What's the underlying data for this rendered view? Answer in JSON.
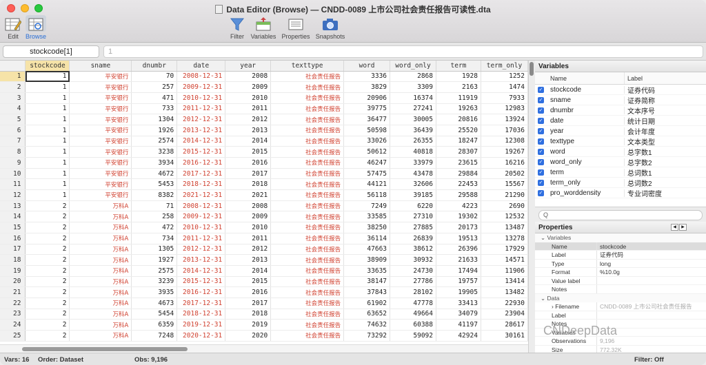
{
  "window": {
    "title": "Data Editor (Browse) — CNDD-0089 上市公司社会责任报告可读性.dta"
  },
  "toolbar": {
    "edit": "Edit",
    "browse": "Browse",
    "filter": "Filter",
    "variables": "Variables",
    "properties": "Properties",
    "snapshots": "Snapshots"
  },
  "cmdbar": {
    "cell_name": "stockcode[1]",
    "cell_value": "1"
  },
  "grid": {
    "columns": [
      "stockcode",
      "sname",
      "dnumbr",
      "date",
      "year",
      "texttype",
      "word",
      "word_only",
      "term",
      "term_only"
    ],
    "rows": [
      [
        "1",
        "1",
        "平安银行",
        "70",
        "2008-12-31",
        "2008",
        "社会责任报告",
        "3336",
        "2868",
        "1928",
        "1252"
      ],
      [
        "2",
        "1",
        "平安银行",
        "257",
        "2009-12-31",
        "2009",
        "社会责任报告",
        "3829",
        "3309",
        "2163",
        "1474"
      ],
      [
        "3",
        "1",
        "平安银行",
        "471",
        "2010-12-31",
        "2010",
        "社会责任报告",
        "20906",
        "16374",
        "11919",
        "7933"
      ],
      [
        "4",
        "1",
        "平安银行",
        "733",
        "2011-12-31",
        "2011",
        "社会责任报告",
        "39775",
        "27241",
        "19263",
        "12983"
      ],
      [
        "5",
        "1",
        "平安银行",
        "1304",
        "2012-12-31",
        "2012",
        "社会责任报告",
        "36477",
        "30005",
        "20816",
        "13924"
      ],
      [
        "6",
        "1",
        "平安银行",
        "1926",
        "2013-12-31",
        "2013",
        "社会责任报告",
        "50598",
        "36439",
        "25520",
        "17036"
      ],
      [
        "7",
        "1",
        "平安银行",
        "2574",
        "2014-12-31",
        "2014",
        "社会责任报告",
        "33026",
        "26355",
        "18247",
        "12308"
      ],
      [
        "8",
        "1",
        "平安银行",
        "3238",
        "2015-12-31",
        "2015",
        "社会责任报告",
        "50612",
        "40818",
        "28307",
        "19267"
      ],
      [
        "9",
        "1",
        "平安银行",
        "3934",
        "2016-12-31",
        "2016",
        "社会责任报告",
        "46247",
        "33979",
        "23615",
        "16216"
      ],
      [
        "10",
        "1",
        "平安银行",
        "4672",
        "2017-12-31",
        "2017",
        "社会责任报告",
        "57475",
        "43478",
        "29884",
        "20502"
      ],
      [
        "11",
        "1",
        "平安银行",
        "5453",
        "2018-12-31",
        "2018",
        "社会责任报告",
        "44121",
        "32606",
        "22453",
        "15567"
      ],
      [
        "12",
        "1",
        "平安银行",
        "8382",
        "2021-12-31",
        "2021",
        "社会责任报告",
        "56118",
        "39185",
        "29588",
        "21290"
      ],
      [
        "13",
        "2",
        "万科A",
        "71",
        "2008-12-31",
        "2008",
        "社会责任报告",
        "7249",
        "6220",
        "4223",
        "2690"
      ],
      [
        "14",
        "2",
        "万科A",
        "258",
        "2009-12-31",
        "2009",
        "社会责任报告",
        "33585",
        "27310",
        "19302",
        "12532"
      ],
      [
        "15",
        "2",
        "万科A",
        "472",
        "2010-12-31",
        "2010",
        "社会责任报告",
        "38250",
        "27885",
        "20173",
        "13487"
      ],
      [
        "16",
        "2",
        "万科A",
        "734",
        "2011-12-31",
        "2011",
        "社会责任报告",
        "36114",
        "26839",
        "19513",
        "13278"
      ],
      [
        "17",
        "2",
        "万科A",
        "1305",
        "2012-12-31",
        "2012",
        "社会责任报告",
        "47663",
        "38612",
        "26396",
        "17929"
      ],
      [
        "18",
        "2",
        "万科A",
        "1927",
        "2013-12-31",
        "2013",
        "社会责任报告",
        "38909",
        "30932",
        "21633",
        "14571"
      ],
      [
        "19",
        "2",
        "万科A",
        "2575",
        "2014-12-31",
        "2014",
        "社会责任报告",
        "33635",
        "24730",
        "17494",
        "11906"
      ],
      [
        "20",
        "2",
        "万科A",
        "3239",
        "2015-12-31",
        "2015",
        "社会责任报告",
        "38147",
        "27786",
        "19757",
        "13414"
      ],
      [
        "21",
        "2",
        "万科A",
        "3935",
        "2016-12-31",
        "2016",
        "社会责任报告",
        "37843",
        "28102",
        "19905",
        "13482"
      ],
      [
        "22",
        "2",
        "万科A",
        "4673",
        "2017-12-31",
        "2017",
        "社会责任报告",
        "61902",
        "47778",
        "33413",
        "22930"
      ],
      [
        "23",
        "2",
        "万科A",
        "5454",
        "2018-12-31",
        "2018",
        "社会责任报告",
        "63652",
        "49664",
        "34079",
        "23904"
      ],
      [
        "24",
        "2",
        "万科A",
        "6359",
        "2019-12-31",
        "2019",
        "社会责任报告",
        "74632",
        "60388",
        "41197",
        "28617"
      ],
      [
        "25",
        "2",
        "万科A",
        "7248",
        "2020-12-31",
        "2020",
        "社会责任报告",
        "73292",
        "59092",
        "42924",
        "30161"
      ]
    ]
  },
  "variables_panel": {
    "title": "Variables",
    "col_name": "Name",
    "col_label": "Label",
    "items": [
      {
        "name": "stockcode",
        "label": "证券代码"
      },
      {
        "name": "sname",
        "label": "证券简称"
      },
      {
        "name": "dnumbr",
        "label": "文本序号"
      },
      {
        "name": "date",
        "label": "统计日期"
      },
      {
        "name": "year",
        "label": "会计年度"
      },
      {
        "name": "texttype",
        "label": "文本类型"
      },
      {
        "name": "word",
        "label": "总字数1"
      },
      {
        "name": "word_only",
        "label": "总字数2"
      },
      {
        "name": "term",
        "label": "总词数1"
      },
      {
        "name": "term_only",
        "label": "总词数2"
      },
      {
        "name": "pro_worddensity",
        "label": "专业词密度"
      }
    ],
    "filter_placeholder": "Q"
  },
  "properties_panel": {
    "title": "Properties",
    "sec_variables": "Variables",
    "name_k": "Name",
    "name_v": "stockcode",
    "label_k": "Label",
    "label_v": "证券代码",
    "type_k": "Type",
    "type_v": "long",
    "format_k": "Format",
    "format_v": "%10.0g",
    "valuelabel_k": "Value label",
    "notes_k": "Notes",
    "sec_data": "Data",
    "filename_k": "Filename",
    "filename_v": "CNDD-0089 上市公司社会责任报告",
    "dlabel_k": "Label",
    "notes2_k": "Notes",
    "var_k": "Variables",
    "var_v": "",
    "obs_k": "Observations",
    "obs_v": "9,196",
    "size_k": "Size",
    "size_v": "772.32K"
  },
  "status": {
    "vars": "Vars: 16",
    "order": "Order: Dataset",
    "obs": "Obs: 9,196",
    "filter": "Filter: Off"
  },
  "watermark": "CNDeepData"
}
